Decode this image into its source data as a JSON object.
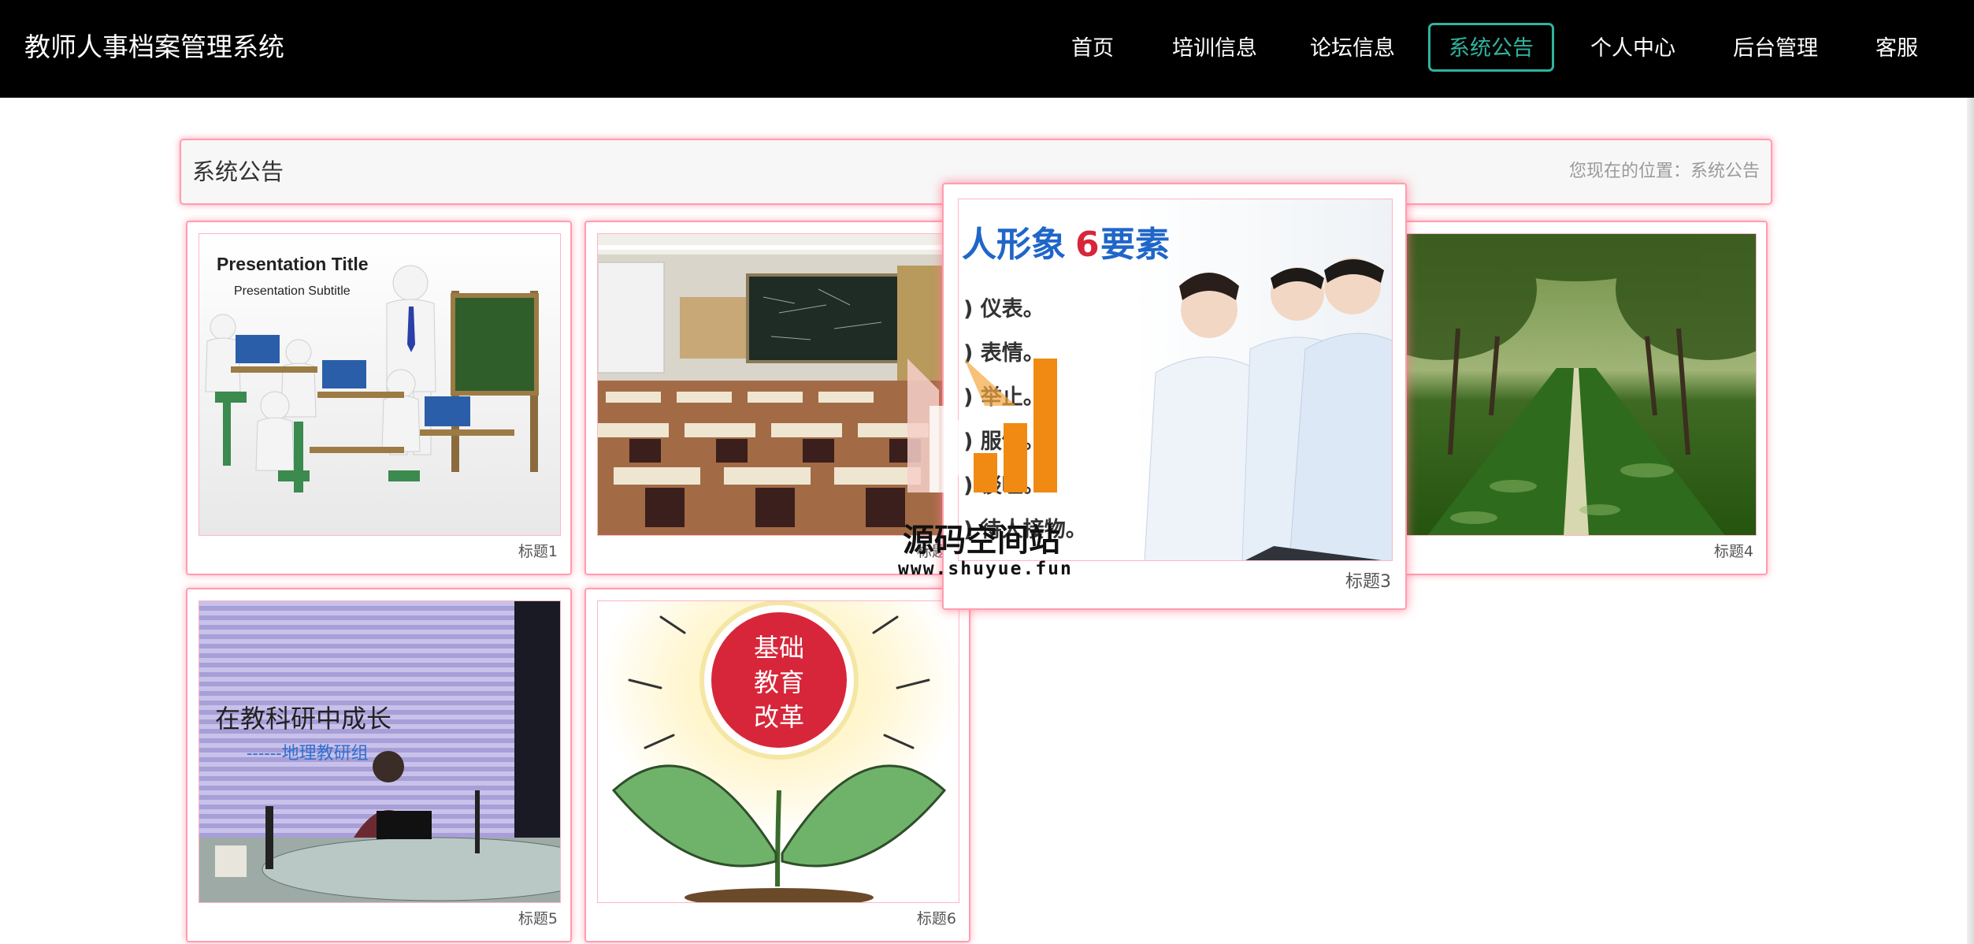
{
  "header": {
    "brand": "教师人事档案管理系统",
    "nav": [
      {
        "label": "首页"
      },
      {
        "label": "培训信息"
      },
      {
        "label": "论坛信息"
      },
      {
        "label": "系统公告",
        "active": true
      },
      {
        "label": "个人中心"
      },
      {
        "label": "后台管理"
      },
      {
        "label": "客服"
      }
    ]
  },
  "title_panel": {
    "title": "系统公告",
    "location": "您现在的位置：系统公告"
  },
  "cards": [
    {
      "caption": "标题1",
      "image_text": {
        "title": "Presentation Title",
        "subtitle": "Presentation Subtitle"
      }
    },
    {
      "caption": "标题2"
    },
    {
      "caption": "标题3",
      "image_text": {
        "headline": "人形象",
        "num": "6",
        "suffix": "要素",
        "items": [
          ") 仪表。",
          ") 表情。",
          ") 举止。",
          ") 服饰。",
          ") 谈吐。",
          ") 待人接物。"
        ]
      }
    },
    {
      "caption": "标题4"
    },
    {
      "caption": "标题5",
      "image_text": {
        "line1": "在教科研中成长",
        "line2": "------地理教研组"
      }
    },
    {
      "caption": "标题6",
      "image_text": {
        "l1": "基础",
        "l2": "教育",
        "l3": "改革"
      }
    }
  ],
  "watermark": {
    "name": "源码空间站",
    "url": "www.shuyue.fun"
  },
  "colors": {
    "navbar_bg": "#000000",
    "active_accent": "#2fb39e",
    "card_border": "#ff9db0",
    "watermark_orange": "#f08a12"
  }
}
